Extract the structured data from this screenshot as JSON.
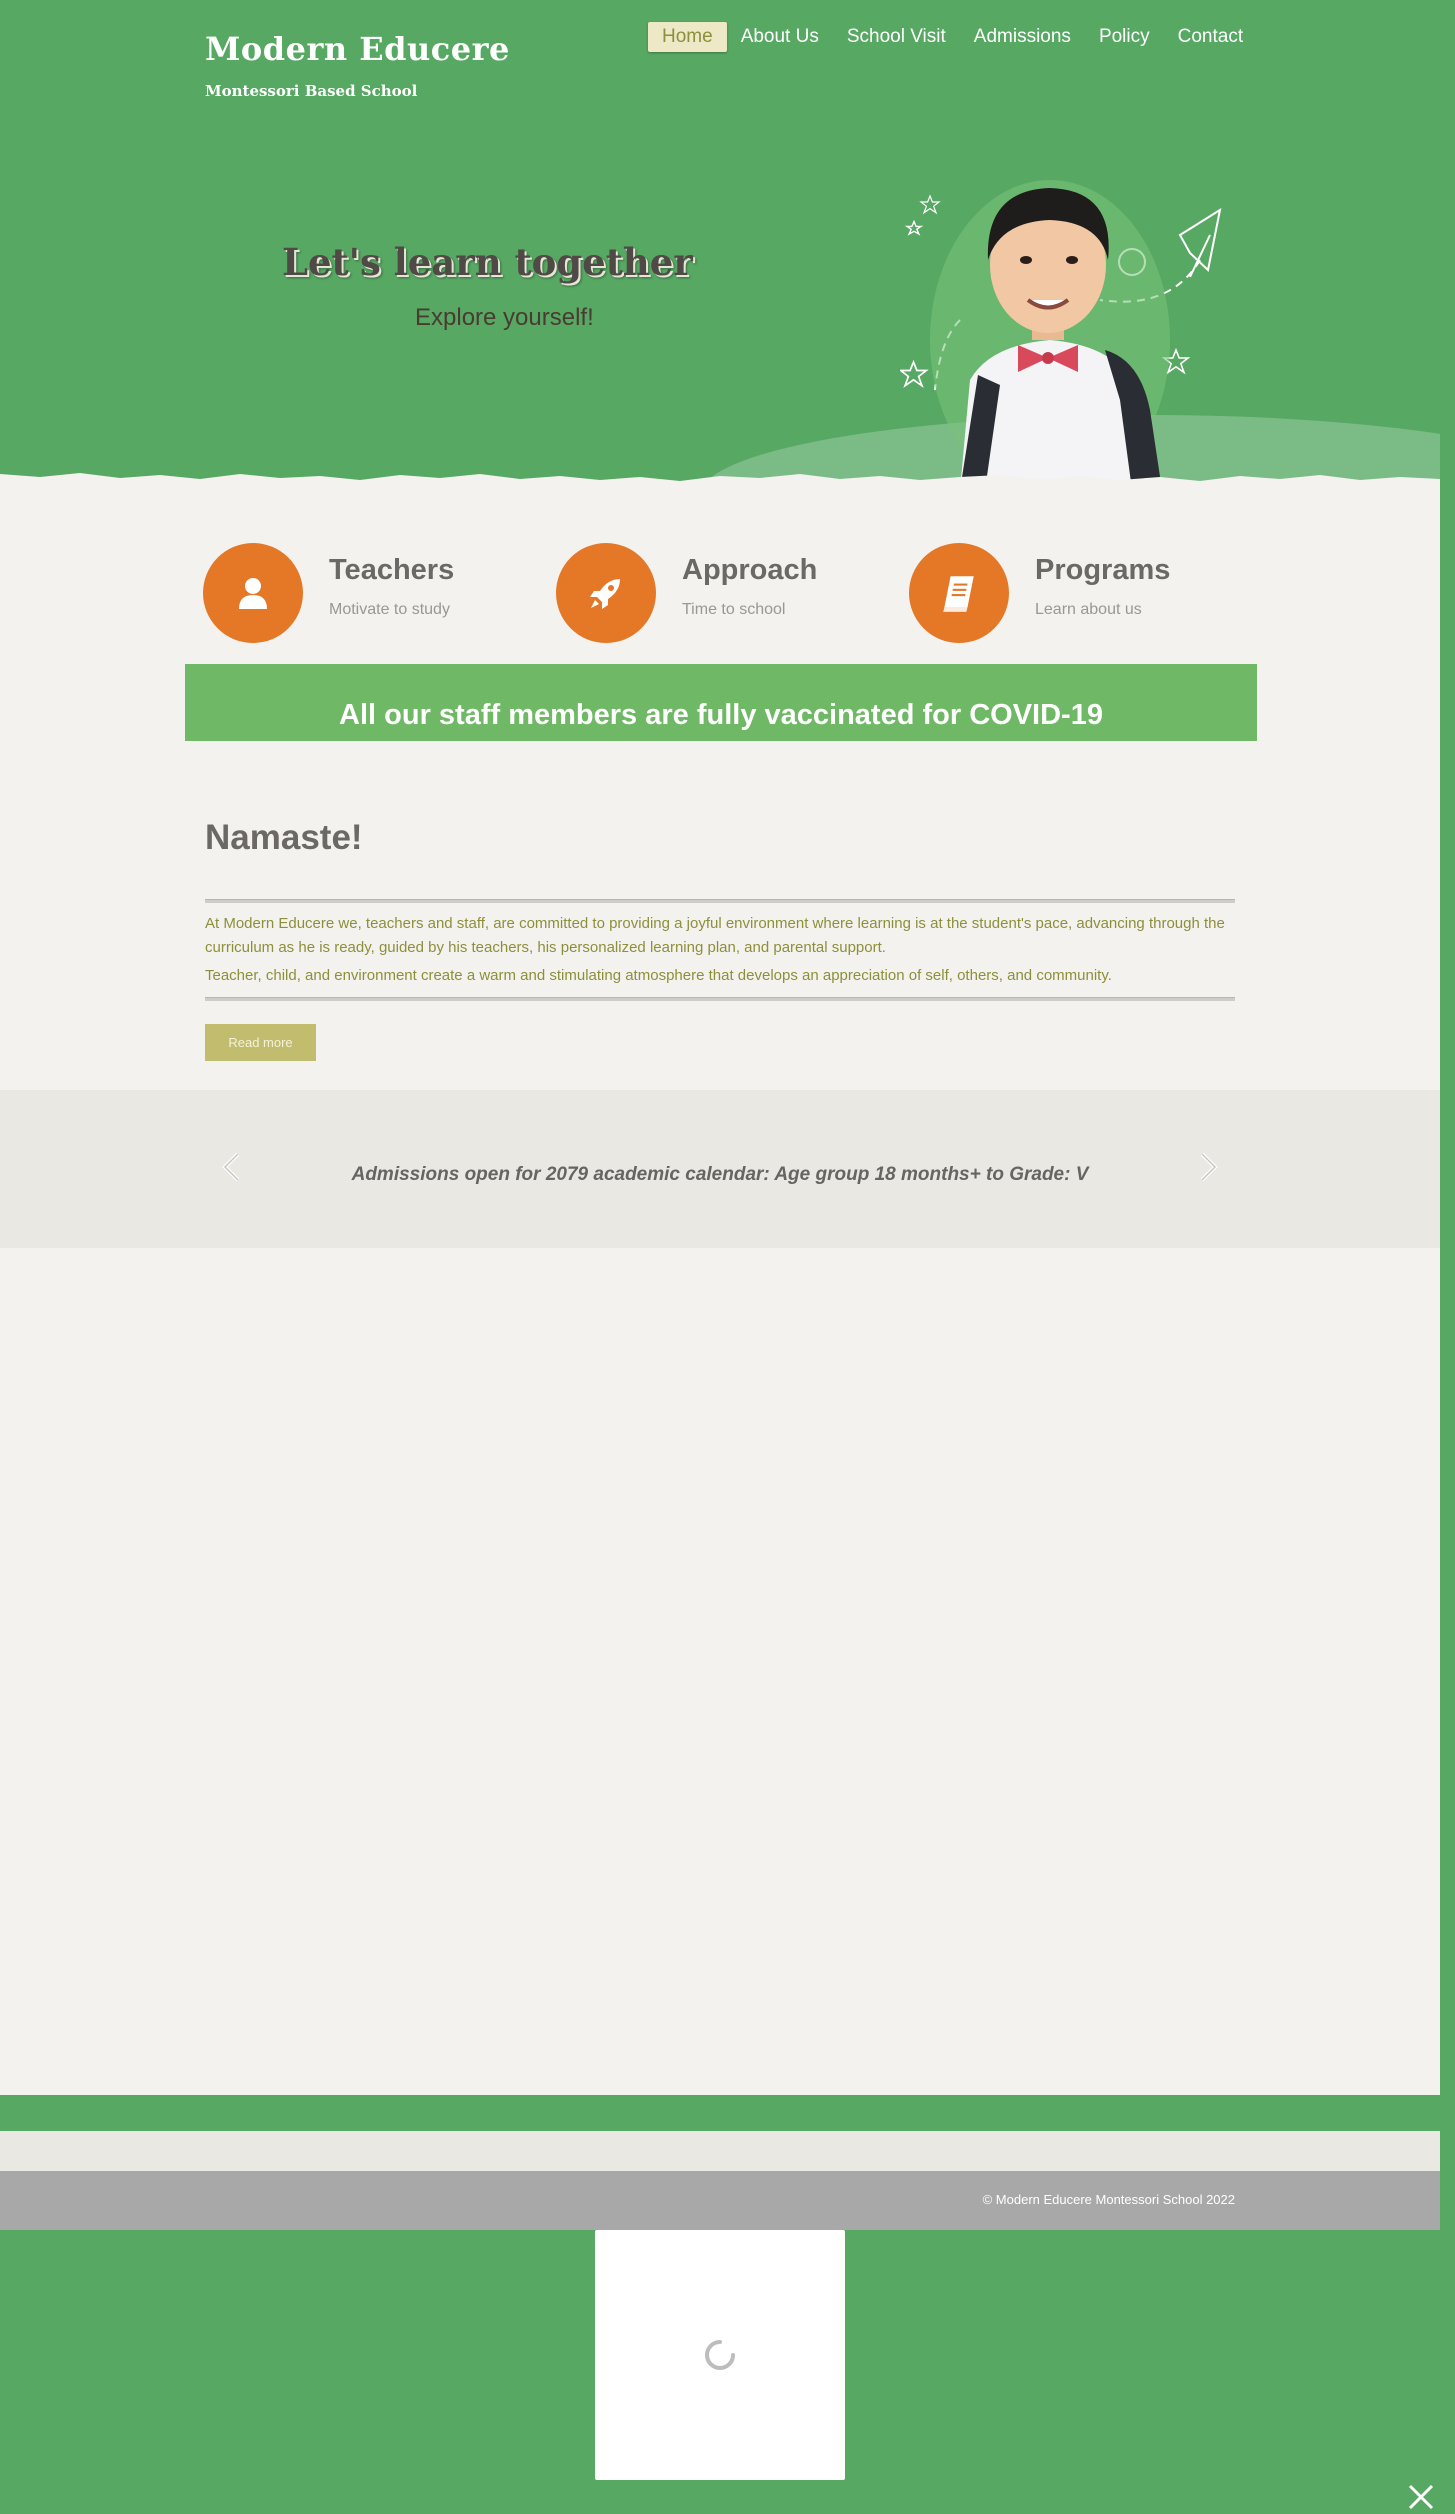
{
  "header": {
    "brand": "Modern Educere",
    "tagline": "Montessori Based School",
    "nav": [
      {
        "label": "Home",
        "active": true
      },
      {
        "label": "About Us",
        "active": false
      },
      {
        "label": "School Visit",
        "active": false
      },
      {
        "label": "Admissions",
        "active": false
      },
      {
        "label": "Policy",
        "active": false
      },
      {
        "label": "Contact",
        "active": false
      }
    ]
  },
  "hero": {
    "title": "Let's learn together",
    "subtitle": "Explore yourself!"
  },
  "features": [
    {
      "title": "Teachers",
      "subtitle": "Motivate to study",
      "icon": "user-icon"
    },
    {
      "title": "Approach",
      "subtitle": "Time to school",
      "icon": "rocket-icon"
    },
    {
      "title": "Programs",
      "subtitle": "Learn about us",
      "icon": "book-icon"
    }
  ],
  "notice": "All our staff members are fully vaccinated for COVID-19",
  "intro": {
    "heading": "Namaste!",
    "paragraph1": "At Modern Educere we, teachers and staff, are committed to providing a joyful environment where learning is at the student's pace, advancing through the curriculum as he is ready, guided by his teachers, his personalized learning plan, and parental support.",
    "paragraph2": "Teacher, child, and environment create a warm and stimulating atmosphere that develops an appreciation of self, others, and community.",
    "read_more": "Read more"
  },
  "slider": {
    "text": "Admissions open for 2079 academic calendar:  Age group 18 months+  to Grade: V"
  },
  "footer": {
    "copyright": "© Modern Educere Montessori School 2022"
  },
  "colors": {
    "brand_green": "#57a863",
    "accent_orange": "#e47827",
    "notice_green": "#6fb865",
    "text_olive": "#8e8f3a"
  }
}
